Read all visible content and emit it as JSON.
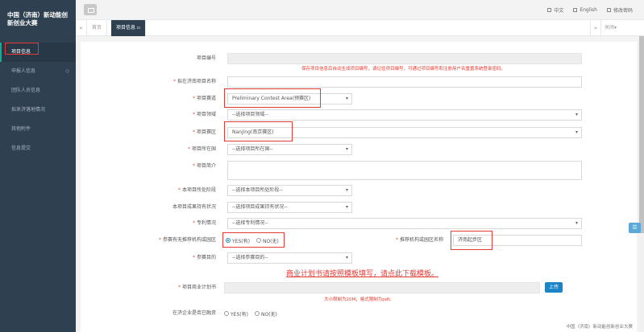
{
  "app": {
    "brand": "中国（济南）新动能创新创业大赛",
    "footer": "中国（济南）新动能创新创业大赛"
  },
  "sidebar": {
    "items": [
      {
        "label": "项目信息",
        "active": true
      },
      {
        "label": "申报人信息",
        "badge": "◇"
      },
      {
        "label": "团队人员信息"
      },
      {
        "label": "拟来济落地情况"
      },
      {
        "label": "其他附件"
      },
      {
        "label": "信息提交"
      }
    ]
  },
  "topbar": {
    "lang_cn": "中文",
    "lang_en": "English",
    "change_password": "修改密码"
  },
  "tabs": {
    "home": "首页",
    "current": "项目信息",
    "close_menu": "关闭▾"
  },
  "form": {
    "project_no_label": "项目编号",
    "project_no_hint": "保存项目信息后自动生成项目编号，请记住项目编号，可通过项目编号和注册用户名重置系统登录密码。",
    "project_name_label": "拟在济南项目名称",
    "track_label": "项目赛道",
    "track_value": "Preliminary Contest Area(预赛区)",
    "field_label": "项目领域",
    "field_placeholder": "--选择项目领域--",
    "division_label": "项目赛区",
    "division_value": "Nanjing(南京赛区)",
    "location_label": "项目所在国",
    "location_placeholder": "--选择项目所在国--",
    "intro_label": "项目简介",
    "stage_label": "本项目所处阶段",
    "stage_placeholder": "--选择本项目所处阶段--",
    "achievement_label": "本项目成果持有状况",
    "achievement_placeholder": "--选择项目成果持有状况--",
    "patent_label": "专利情况",
    "patent_placeholder": "--选择专利情况--",
    "recommend_label": "参赛有无推荐机构或园区",
    "yes_label": "YES(有)",
    "no_label": "NO(无)",
    "recommend_org_label": "推荐机构或园区名称",
    "recommend_org_value": "济南起步区",
    "purpose_label": "参赛目的",
    "purpose_placeholder": "--选择参赛目的--",
    "template_link": "商业计划书请按照模板填写，请点此下载模板。",
    "bp_label": "项目商业计划书",
    "upload_label": "上传",
    "bp_hint": "大小限制为20M，格式限制为pdf。",
    "financing_label": "在济企业是否已融资",
    "financing_yes": "YES(有)",
    "financing_no": "NO(无)"
  },
  "colors": {
    "sidebar_bg": "#2f4050",
    "highlight": "#e53935",
    "accent": "#1c84c6"
  }
}
